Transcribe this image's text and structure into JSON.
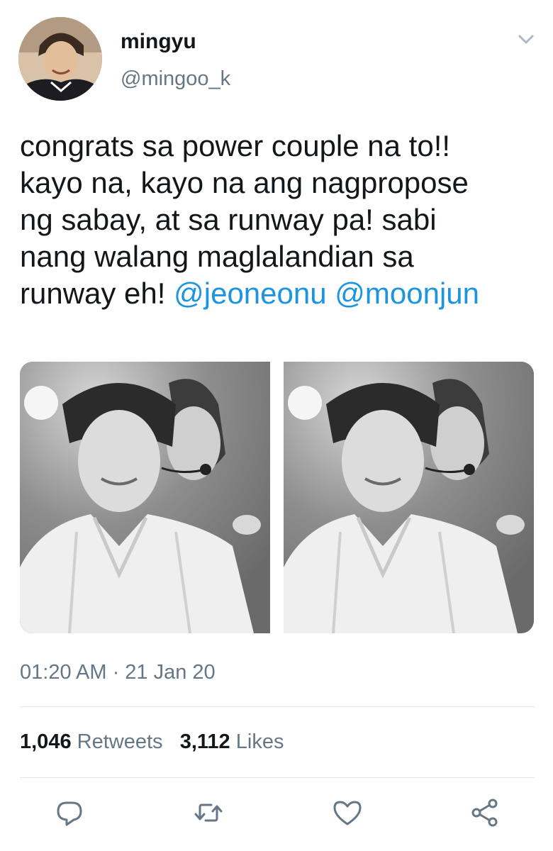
{
  "tweet": {
    "author_name": "mingyu",
    "author_handle": "@mingoo_k",
    "text_lines": [
      "congrats sa power couple na to!!",
      "kayo na, kayo na ang nagpropose",
      "ng sabay, at sa runway pa! sabi",
      "nang walang maglalandian sa",
      "runway eh! "
    ],
    "mentions": [
      "@jeoneonu",
      "@moonjun"
    ],
    "timestamp": "01:20 AM · 21 Jan 20",
    "retweets_count": "1,046",
    "retweets_label": "Retweets",
    "likes_count": "3,112",
    "likes_label": "Likes"
  },
  "colors": {
    "mention": "#1b95e0",
    "secondary_text": "#657786",
    "divider": "#e1e8ed"
  },
  "icons": {
    "menu": "chevron-down-icon",
    "reply": "reply-icon",
    "retweet": "retweet-icon",
    "like": "heart-icon",
    "share": "share-icon"
  }
}
